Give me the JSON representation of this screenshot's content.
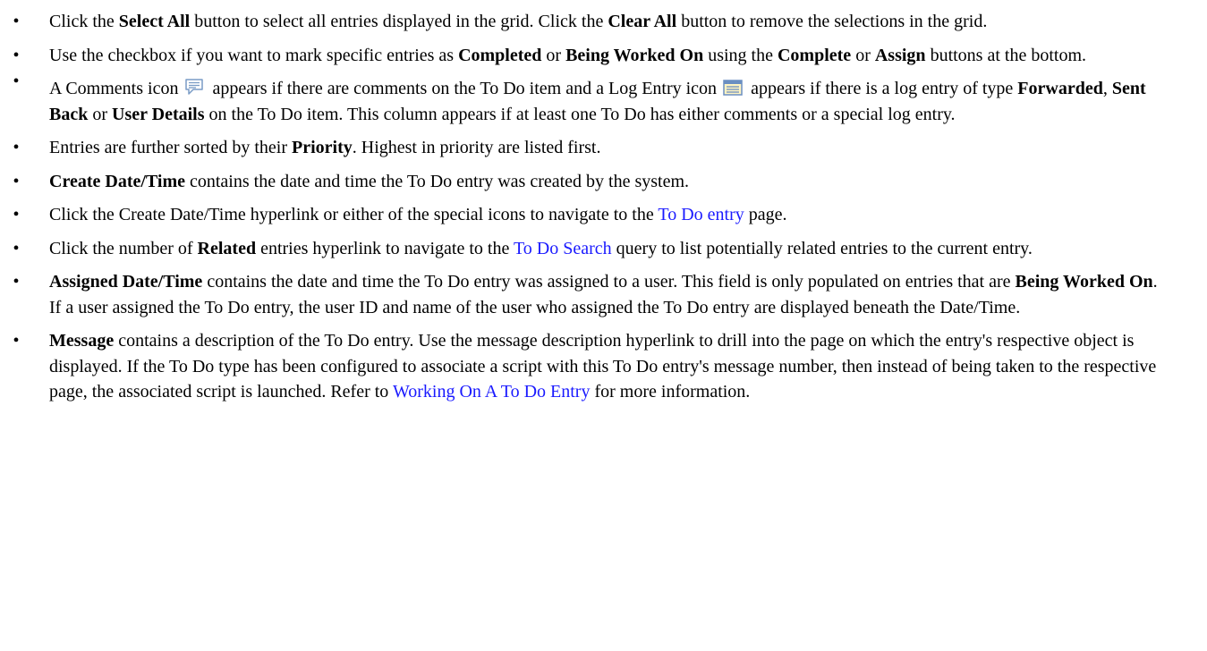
{
  "bullet_glyph": "•",
  "items": [
    {
      "p1": "Click the ",
      "b1": "Select All",
      "p2": " button to select all entries displayed in the grid. Click the ",
      "b2": "Clear All",
      "p3": " button to remove the selections in the grid."
    },
    {
      "p1": "Use the checkbox if you want to mark specific entries as ",
      "b1": "Completed",
      "p2": " or ",
      "b2": "Being Worked On",
      "p3": " using the ",
      "b3": "Complete",
      "p4": " or ",
      "b4": "Assign",
      "p5": " buttons at the bottom."
    },
    {
      "p1": "A Comments icon ",
      "p2": " appears if there are comments on the To Do item and a Log Entry icon ",
      "p3": " appears if there is a log entry of type ",
      "b1": "Forwarded",
      "p4": ", ",
      "b2": "Sent Back",
      "p5": " or ",
      "b3": "User Details",
      "p6": " on the To Do item. This column appears if at least one To Do has either comments or a special log entry.",
      "icon1": "comments-icon",
      "icon2": "log-entry-icon"
    },
    {
      "p1": "Entries are further sorted by their ",
      "b1": "Priority",
      "p2": ". Highest in priority are listed first."
    },
    {
      "b1": "Create Date/Time",
      "p1": " contains the date and time the To Do entry was created by the system."
    },
    {
      "p1": "Click the Create Date/Time hyperlink or either of the special icons to navigate to the ",
      "link1": "To Do entry",
      "p2": " page."
    },
    {
      "p1": "Click the number of ",
      "b1": "Related",
      "p2": " entries hyperlink to navigate to the ",
      "link1": "To Do Search",
      "p3": " query to list potentially related entries to the current entry."
    },
    {
      "b1": "Assigned Date/Time",
      "p1": " contains the date and time the To Do entry was assigned to a user. This field is only populated on entries that are ",
      "b2": "Being Worked On",
      "p2": ". If a user assigned the To Do entry, the user ID and name of the user who assigned the To Do entry are displayed beneath the Date/Time."
    },
    {
      "b1": "Message",
      "p1": " contains a description of the To Do entry. Use the message description hyperlink to drill into the page on which the entry's respective object is displayed. If the To Do type has been configured to associate a script with this To Do entry's message number, then instead of being taken to the respective page, the associated script is launched. Refer to ",
      "link1": "Working On A To Do Entry",
      "p2": " for more information."
    }
  ],
  "colors": {
    "text": "#000000",
    "link": "#1a1aff",
    "comments_icon": "#7a9cc6",
    "log_icon_frame": "#6b8fc2",
    "log_icon_fill": "#fff4c2"
  }
}
